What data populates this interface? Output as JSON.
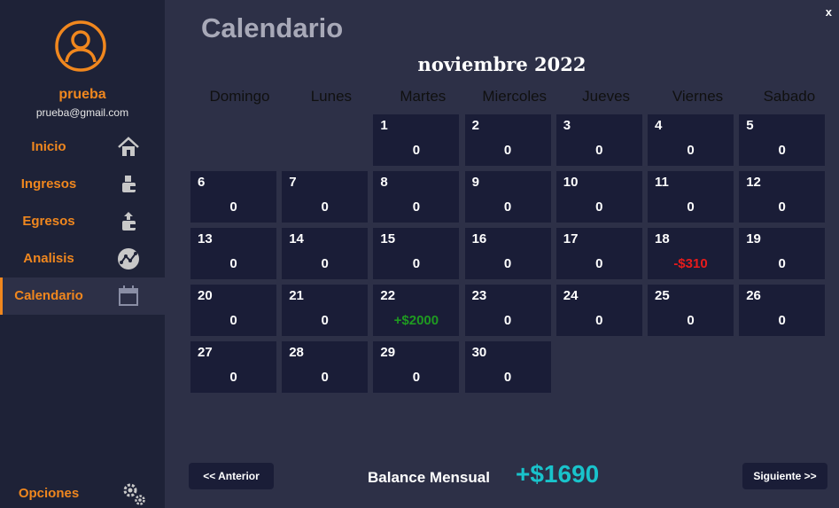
{
  "window": {
    "close_label": "x"
  },
  "sidebar": {
    "user_name": "prueba",
    "user_email": "prueba@gmail.com",
    "nav": [
      {
        "label": "Inicio",
        "icon": "home-icon"
      },
      {
        "label": "Ingresos",
        "icon": "wallet-in-icon"
      },
      {
        "label": "Egresos",
        "icon": "wallet-out-icon"
      },
      {
        "label": "Analisis",
        "icon": "analytics-icon"
      },
      {
        "label": "Calendario",
        "icon": "calendar-icon",
        "active": true
      }
    ],
    "options_label": "Opciones",
    "options_icon": "gears-icon",
    "accent_color": "#f0871e"
  },
  "main": {
    "title": "Calendario",
    "month_title": "noviembre 2022",
    "weekdays": [
      "Domingo",
      "Lunes",
      "Martes",
      "Miercoles",
      "Jueves",
      "Viernes",
      "Sabado"
    ],
    "days": [
      {
        "day": "1",
        "amount": "0",
        "kind": "zero"
      },
      {
        "day": "2",
        "amount": "0",
        "kind": "zero"
      },
      {
        "day": "3",
        "amount": "0",
        "kind": "zero"
      },
      {
        "day": "4",
        "amount": "0",
        "kind": "zero"
      },
      {
        "day": "5",
        "amount": "0",
        "kind": "zero"
      },
      {
        "day": "6",
        "amount": "0",
        "kind": "zero"
      },
      {
        "day": "7",
        "amount": "0",
        "kind": "zero"
      },
      {
        "day": "8",
        "amount": "0",
        "kind": "zero"
      },
      {
        "day": "9",
        "amount": "0",
        "kind": "zero"
      },
      {
        "day": "10",
        "amount": "0",
        "kind": "zero"
      },
      {
        "day": "11",
        "amount": "0",
        "kind": "zero"
      },
      {
        "day": "12",
        "amount": "0",
        "kind": "zero"
      },
      {
        "day": "13",
        "amount": "0",
        "kind": "zero"
      },
      {
        "day": "14",
        "amount": "0",
        "kind": "zero"
      },
      {
        "day": "15",
        "amount": "0",
        "kind": "zero"
      },
      {
        "day": "16",
        "amount": "0",
        "kind": "zero"
      },
      {
        "day": "17",
        "amount": "0",
        "kind": "zero"
      },
      {
        "day": "18",
        "amount": "-$310",
        "kind": "neg"
      },
      {
        "day": "19",
        "amount": "0",
        "kind": "zero"
      },
      {
        "day": "20",
        "amount": "0",
        "kind": "zero"
      },
      {
        "day": "21",
        "amount": "0",
        "kind": "zero"
      },
      {
        "day": "22",
        "amount": "+$2000",
        "kind": "pos"
      },
      {
        "day": "23",
        "amount": "0",
        "kind": "zero"
      },
      {
        "day": "24",
        "amount": "0",
        "kind": "zero"
      },
      {
        "day": "25",
        "amount": "0",
        "kind": "zero"
      },
      {
        "day": "26",
        "amount": "0",
        "kind": "zero"
      },
      {
        "day": "27",
        "amount": "0",
        "kind": "zero"
      },
      {
        "day": "28",
        "amount": "0",
        "kind": "zero"
      },
      {
        "day": "29",
        "amount": "0",
        "kind": "zero"
      },
      {
        "day": "30",
        "amount": "0",
        "kind": "zero"
      }
    ],
    "prev_label": "<< Anterior",
    "next_label": "Siguiente >>",
    "balance_label": "Balance Mensual",
    "balance_value": "+$1690",
    "colors": {
      "negative": "#e81b1b",
      "positive": "#1f9a21",
      "balance": "#19c3cb"
    }
  }
}
